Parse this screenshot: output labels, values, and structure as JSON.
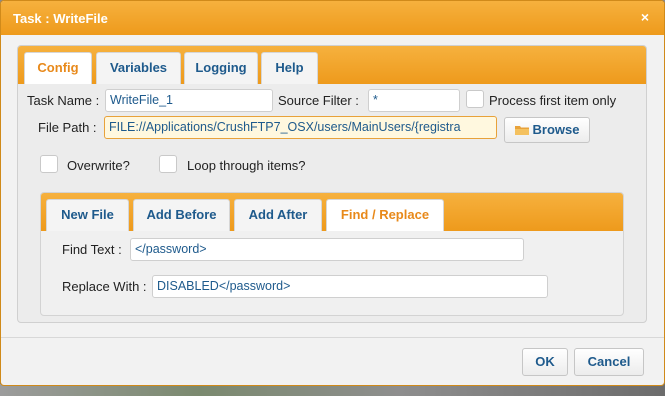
{
  "window": {
    "title": "Task : WriteFile",
    "close_symbol": "×"
  },
  "tabs": [
    {
      "label": "Config",
      "active": true
    },
    {
      "label": "Variables",
      "active": false
    },
    {
      "label": "Logging",
      "active": false
    },
    {
      "label": "Help",
      "active": false
    }
  ],
  "config": {
    "task_name_label": "Task Name :",
    "task_name_value": "WriteFile_1",
    "source_filter_label": "Source Filter :",
    "source_filter_value": "*",
    "process_first_label": "Process first item only",
    "file_path_label": "File Path :",
    "file_path_value": "FILE://Applications/CrushFTP7_OSX/users/MainUsers/{registra",
    "browse_label": "Browse",
    "overwrite_label": "Overwrite?",
    "loop_label": "Loop through items?"
  },
  "subtabs": [
    {
      "label": "New File",
      "active": false
    },
    {
      "label": "Add Before",
      "active": false
    },
    {
      "label": "Add After",
      "active": false
    },
    {
      "label": "Find / Replace",
      "active": true
    }
  ],
  "find_replace": {
    "find_label": "Find Text :",
    "find_value": "</password>",
    "replace_label": "Replace With :",
    "replace_value": "DISABLED</password>"
  },
  "footer": {
    "ok_label": "OK",
    "cancel_label": "Cancel"
  },
  "colors": {
    "accent_orange": "#ee9a1c",
    "link_blue": "#1e5a8c",
    "active_tab_text": "#e8891a"
  },
  "icons": {
    "close": "close-icon",
    "browse": "folder-icon"
  }
}
